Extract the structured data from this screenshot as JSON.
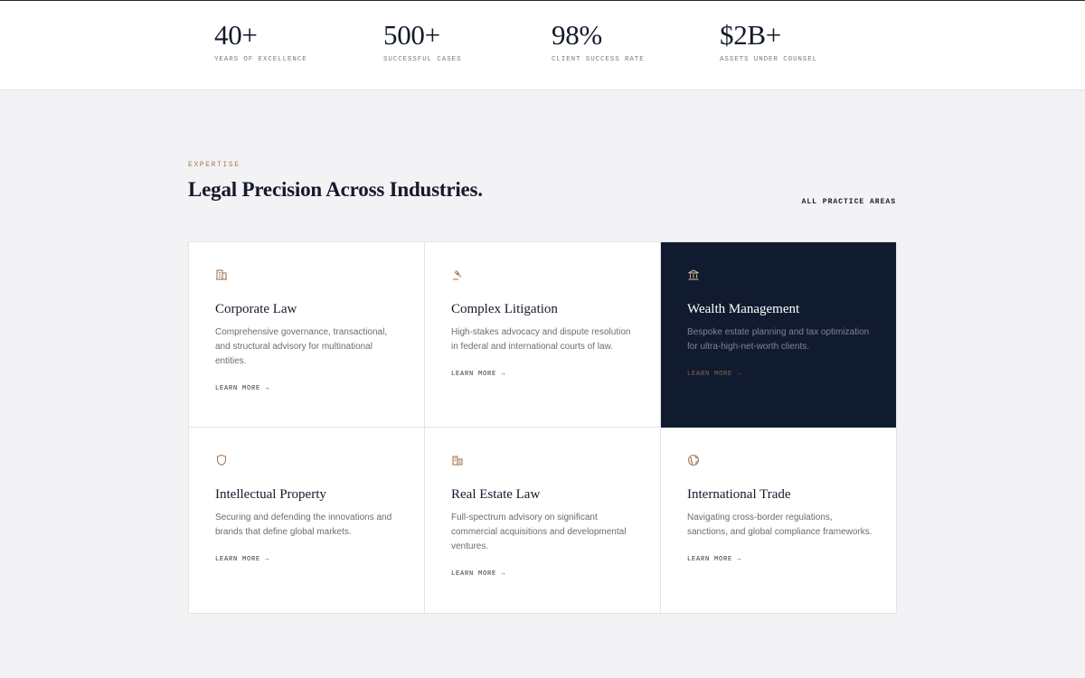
{
  "stats": [
    {
      "value": "40+",
      "label": "YEARS OF EXCELLENCE"
    },
    {
      "value": "500+",
      "label": "SUCCESSFUL CASES"
    },
    {
      "value": "98%",
      "label": "CLIENT SUCCESS RATE"
    },
    {
      "value": "$2B+",
      "label": "ASSETS UNDER COUNSEL"
    }
  ],
  "expertise": {
    "eyebrow": "EXPERTISE",
    "title": "Legal Precision Across Industries.",
    "all_link": "ALL PRACTICE AREAS",
    "accent_color": "#a57a55",
    "dark_card_color": "#111b30",
    "cards": [
      {
        "icon": "building-icon",
        "title": "Corporate Law",
        "description": "Comprehensive governance, transactional, and structural advisory for multinational entities.",
        "link": "LEARN MORE →"
      },
      {
        "icon": "gavel-icon",
        "title": "Complex Litigation",
        "description": "High-stakes advocacy and dispute resolution in federal and international courts of law.",
        "link": "LEARN MORE →"
      },
      {
        "icon": "bank-icon",
        "title": "Wealth Management",
        "description": "Bespoke estate planning and tax optimization for ultra-high-net-worth clients.",
        "link": "LEARN MORE →"
      },
      {
        "icon": "shield-icon",
        "title": "Intellectual Property",
        "description": "Securing and defending the innovations and brands that define global markets.",
        "link": "LEARN MORE →"
      },
      {
        "icon": "buildings-icon",
        "title": "Real Estate Law",
        "description": "Full-spectrum advisory on significant commercial acquisitions and developmental ventures.",
        "link": "LEARN MORE →"
      },
      {
        "icon": "globe-icon",
        "title": "International Trade",
        "description": "Navigating cross-border regulations, sanctions, and global compliance frameworks.",
        "link": "LEARN MORE →"
      }
    ]
  }
}
